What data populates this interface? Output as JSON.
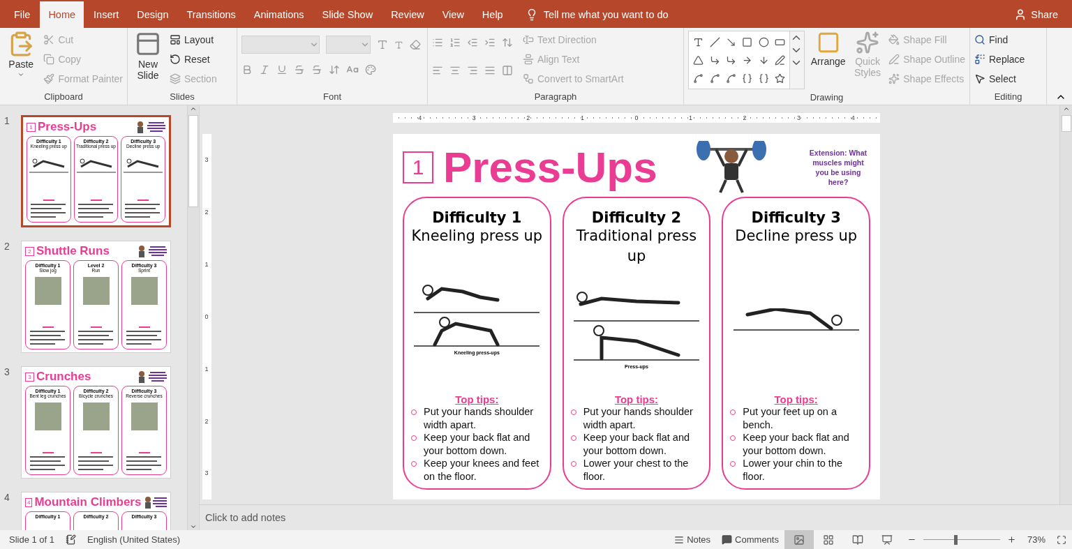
{
  "tabs": [
    {
      "label": "File",
      "selected": false
    },
    {
      "label": "Home",
      "selected": true
    },
    {
      "label": "Insert",
      "selected": false
    },
    {
      "label": "Design",
      "selected": false
    },
    {
      "label": "Transitions",
      "selected": false
    },
    {
      "label": "Animations",
      "selected": false
    },
    {
      "label": "Slide Show",
      "selected": false
    },
    {
      "label": "Review",
      "selected": false
    },
    {
      "label": "View",
      "selected": false
    },
    {
      "label": "Help",
      "selected": false
    }
  ],
  "tell_me": "Tell me what you want to do",
  "share": "Share",
  "ribbon": {
    "clipboard": {
      "label": "Clipboard",
      "paste": "Paste",
      "cut": {
        "label": "Cut",
        "disabled": true
      },
      "copy": {
        "label": "Copy",
        "disabled": true
      },
      "format_painter": {
        "label": "Format Painter",
        "disabled": true
      }
    },
    "slides": {
      "label": "Slides",
      "new_slide": "New Slide",
      "layout": {
        "label": "Layout",
        "disabled": false
      },
      "reset": {
        "label": "Reset",
        "disabled": false
      },
      "section": {
        "label": "Section",
        "disabled": true
      }
    },
    "font": {
      "label": "Font"
    },
    "paragraph": {
      "label": "Paragraph",
      "text_direction": {
        "label": "Text Direction",
        "disabled": true
      },
      "align_text": {
        "label": "Align Text",
        "disabled": true
      },
      "smartart": {
        "label": "Convert to SmartArt",
        "disabled": true
      }
    },
    "drawing": {
      "label": "Drawing",
      "arrange": "Arrange",
      "quick_styles": {
        "label": "Quick Styles",
        "disabled": true
      },
      "shape_fill": {
        "label": "Shape Fill",
        "disabled": true
      },
      "shape_outline": {
        "label": "Shape Outline",
        "disabled": true
      },
      "shape_effects": {
        "label": "Shape Effects",
        "disabled": true
      }
    },
    "editing": {
      "label": "Editing",
      "find": "Find",
      "replace": "Replace",
      "select": "Select"
    }
  },
  "thumbnails": [
    {
      "index": "1",
      "number": "1",
      "title": "Press-Ups",
      "selected": true,
      "cards": [
        {
          "heading": "Difficulty 1",
          "name": "Kneeling press up",
          "kind": "drawing"
        },
        {
          "heading": "Difficulty 2",
          "name": "Traditional press up",
          "kind": "drawing"
        },
        {
          "heading": "Difficulty 3",
          "name": "Decline press up",
          "kind": "drawing"
        }
      ]
    },
    {
      "index": "2",
      "number": "2",
      "title": "Shuttle Runs",
      "selected": false,
      "cards": [
        {
          "heading": "Difficulty 1",
          "name": "Slow jog",
          "kind": "photo"
        },
        {
          "heading": "Level 2",
          "name": "Run",
          "kind": "photo"
        },
        {
          "heading": "Difficulty 3",
          "name": "Sprint",
          "kind": "photo"
        }
      ]
    },
    {
      "index": "3",
      "number": "3",
      "title": "Crunches",
      "selected": false,
      "cards": [
        {
          "heading": "Difficulty 1",
          "name": "Bent leg crunches",
          "kind": "photo"
        },
        {
          "heading": "Difficulty 2",
          "name": "Bicycle crunches",
          "kind": "photo"
        },
        {
          "heading": "Difficulty 3",
          "name": "Reverse crunches",
          "kind": "photo"
        }
      ]
    },
    {
      "index": "4",
      "number": "4",
      "title": "Mountain Climbers",
      "selected": false,
      "cards": [
        {
          "heading": "Difficulty 1",
          "kind": "none"
        },
        {
          "heading": "Difficulty 2",
          "kind": "none"
        },
        {
          "heading": "Difficulty 3",
          "kind": "none"
        }
      ]
    }
  ],
  "ruler": {
    "horizontal": [
      "4",
      "3",
      "2",
      "1",
      "0",
      "1",
      "2",
      "3",
      "4"
    ],
    "vertical": [
      "3",
      "2",
      "1",
      "0",
      "1",
      "2",
      "3"
    ]
  },
  "slide": {
    "number": "1",
    "title": "Press-Ups",
    "extension": "Extension: What muscles might you  be using here?",
    "cards": [
      {
        "heading": "Difficulty 1",
        "name": "Kneeling press up",
        "illustrations": [
          {
            "kind": "kneeling"
          },
          {
            "kind": "crawl"
          }
        ],
        "caption": "Kneeling press-ups",
        "tips_title": "Top tips:",
        "tips": [
          "Put your hands shoulder width apart.",
          "Keep your back flat and your bottom down.",
          "Keep your knees and feet on the floor."
        ]
      },
      {
        "heading": "Difficulty 2",
        "name": "Traditional press up",
        "illustrations": [
          {
            "kind": "plank-low"
          },
          {
            "kind": "plank-high"
          }
        ],
        "caption": "Press-ups",
        "tips_title": "Top tips:",
        "tips": [
          "Put your hands shoulder width apart.",
          "Keep your back flat and your bottom down.",
          "Lower your chest to the floor."
        ]
      },
      {
        "heading": "Difficulty 3",
        "name": "Decline press up",
        "illustrations": [
          {
            "kind": "decline"
          }
        ],
        "tips_title": "Top tips:",
        "tips": [
          "Put your feet up on a bench.",
          "Keep your back flat and your bottom down.",
          "Lower your chin to the floor."
        ]
      }
    ]
  },
  "notes_placeholder": "Click to add notes",
  "status": {
    "slide": "Slide 1 of 1",
    "language": "English (United States)",
    "notes": "Notes",
    "comments": "Comments",
    "views": [
      {
        "kind": "normal",
        "selected": true
      },
      {
        "kind": "sorter",
        "selected": false
      },
      {
        "kind": "reading",
        "selected": false
      },
      {
        "kind": "show",
        "selected": false
      }
    ],
    "zoom": {
      "level": 0.42,
      "reading": "73%"
    }
  }
}
